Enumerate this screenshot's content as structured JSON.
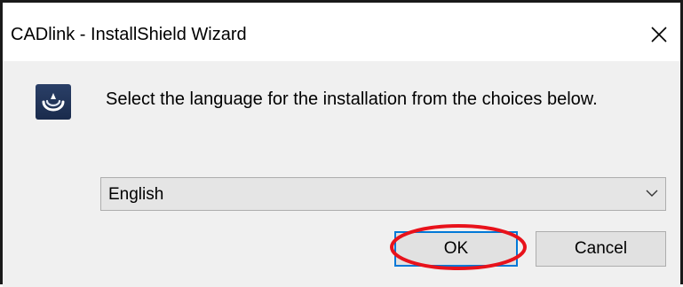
{
  "window": {
    "title": "CADlink - InstallShield Wizard",
    "close_icon": "close-icon"
  },
  "dialog": {
    "icon": "installer-icon",
    "prompt": "Select the language for the installation from the choices below.",
    "language_select": {
      "selected": "English",
      "icon": "chevron-down-icon"
    },
    "buttons": {
      "ok": "OK",
      "cancel": "Cancel"
    }
  },
  "annotation": {
    "shape": "ellipse",
    "color": "#e8121b"
  }
}
